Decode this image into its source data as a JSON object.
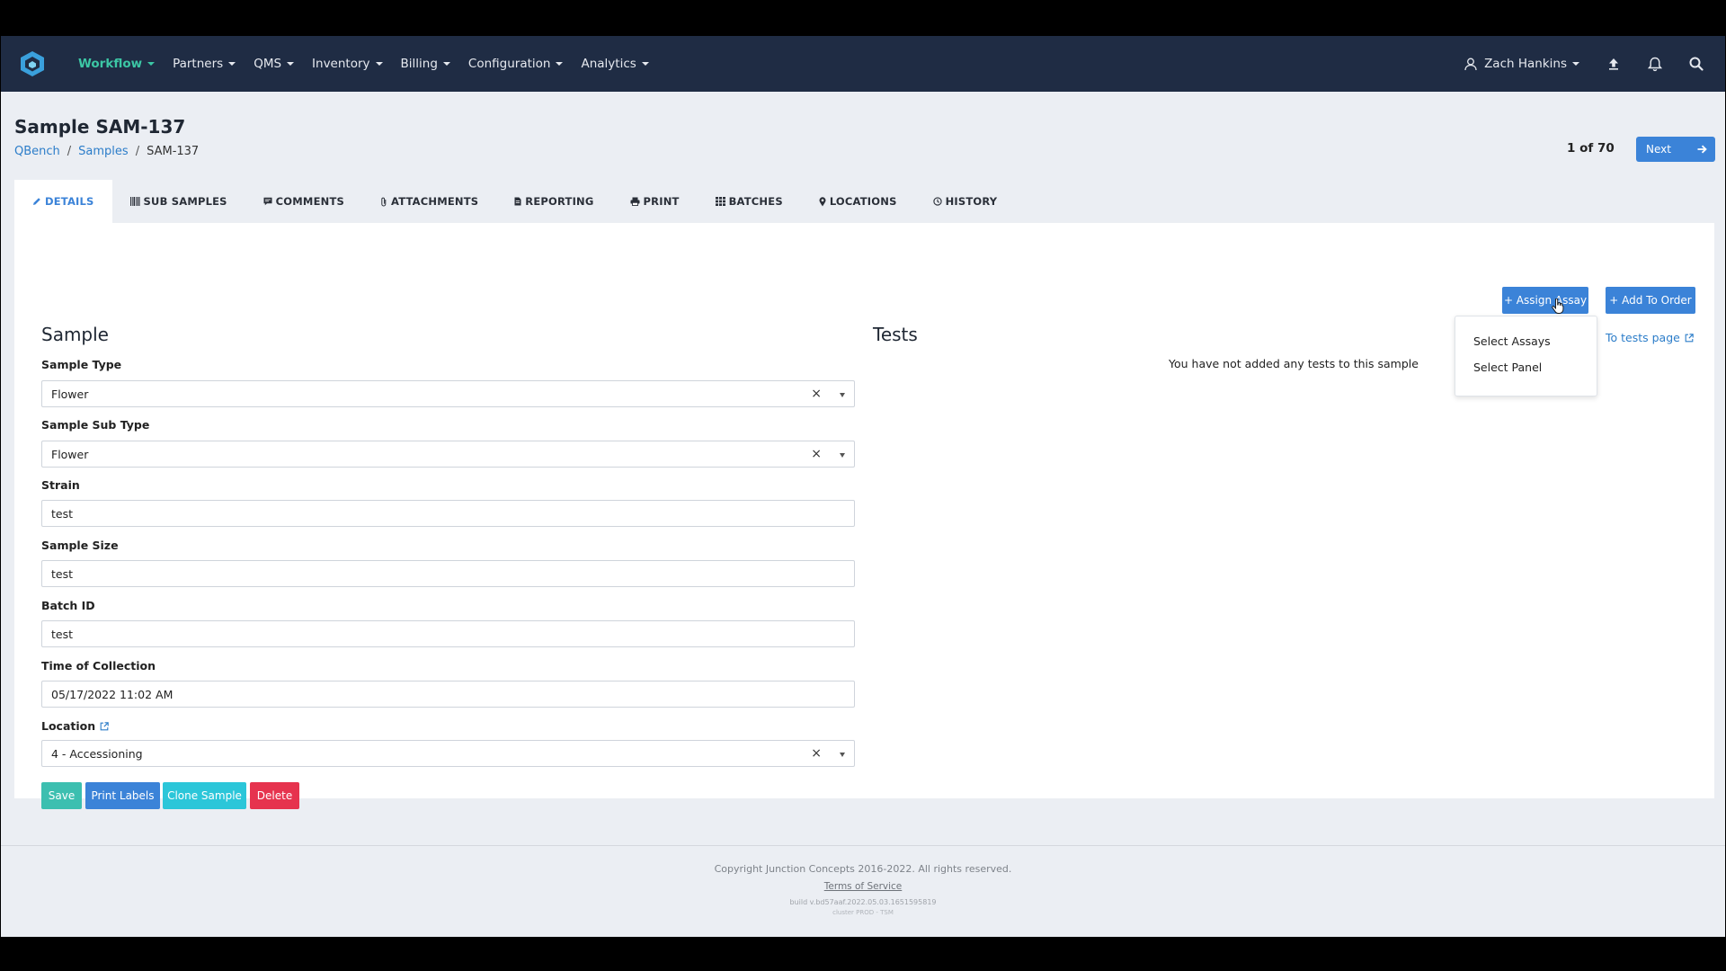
{
  "nav": {
    "items": [
      {
        "label": "Workflow",
        "active": true
      },
      {
        "label": "Partners"
      },
      {
        "label": "QMS"
      },
      {
        "label": "Inventory"
      },
      {
        "label": "Billing"
      },
      {
        "label": "Configuration"
      },
      {
        "label": "Analytics"
      }
    ],
    "user": "Zach Hankins",
    "icons": [
      "user-icon",
      "upload-icon",
      "bell-icon",
      "search-icon"
    ]
  },
  "header": {
    "title": "Sample SAM-137",
    "breadcrumb": [
      "QBench",
      "Samples",
      "SAM-137"
    ],
    "breadcrumb_sep": "/",
    "pager": "1 of 70",
    "next_label": "Next"
  },
  "tabs": [
    {
      "label": "DETAILS",
      "icon": "pencil-icon",
      "active": true
    },
    {
      "label": "SUB SAMPLES",
      "icon": "barcode-icon"
    },
    {
      "label": "COMMENTS",
      "icon": "comment-icon"
    },
    {
      "label": "ATTACHMENTS",
      "icon": "paperclip-icon"
    },
    {
      "label": "REPORTING",
      "icon": "file-icon"
    },
    {
      "label": "PRINT",
      "icon": "printer-icon"
    },
    {
      "label": "BATCHES",
      "icon": "grid-icon"
    },
    {
      "label": "LOCATIONS",
      "icon": "map-pin-icon"
    },
    {
      "label": "HISTORY",
      "icon": "history-icon"
    }
  ],
  "sample": {
    "title": "Sample",
    "fields": {
      "sample_type": {
        "label": "Sample Type",
        "value": "Flower"
      },
      "sample_sub_type": {
        "label": "Sample Sub Type",
        "value": "Flower"
      },
      "strain": {
        "label": "Strain",
        "value": "test"
      },
      "sample_size": {
        "label": "Sample Size",
        "value": "test"
      },
      "batch_id": {
        "label": "Batch ID",
        "value": "test"
      },
      "time_of_collection": {
        "label": "Time of Collection",
        "value": "05/17/2022 11:02 AM"
      },
      "location": {
        "label": "Location",
        "value": "4 - Accessioning"
      }
    },
    "clear_glyph": "×",
    "actions": {
      "save": "Save",
      "print_labels": "Print Labels",
      "clone": "Clone Sample",
      "delete": "Delete"
    }
  },
  "tests": {
    "title": "Tests",
    "empty_message": "You have not added any tests to this sample",
    "link": "To tests page",
    "assign_assay": "+ Assign Assay",
    "add_to_order": "+ Add To Order",
    "dropdown": [
      "Select Assays",
      "Select Panel"
    ]
  },
  "footer": {
    "copyright": "Copyright Junction Concepts 2016-2022. All rights reserved.",
    "terms": "Terms of Service",
    "build": "build v.bd57aaf.2022.05.03.1651595819",
    "cluster": "cluster PROD - TSM"
  },
  "colors": {
    "nav_bg": "#1f2c44",
    "active_nav": "#3cc7a5",
    "primary": "#3b83d8",
    "save": "#3cbfb0",
    "clone": "#2bc6d9",
    "delete": "#e6334e",
    "page_bg": "#ebeef3"
  }
}
